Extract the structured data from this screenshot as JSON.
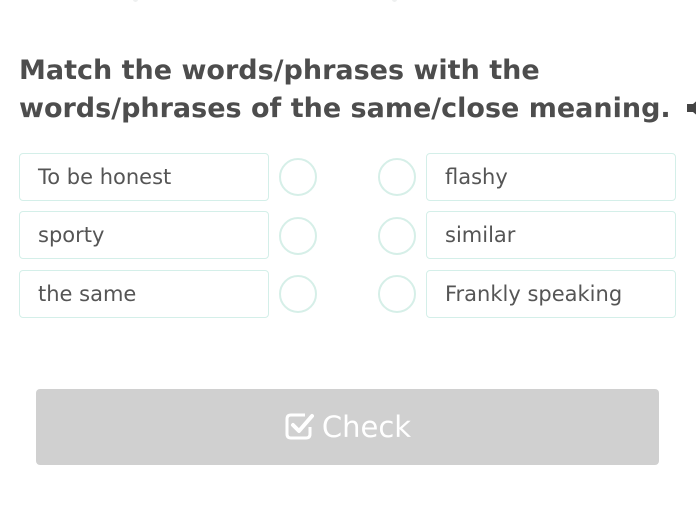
{
  "task": {
    "title_line1": "Match the words/phrases with the",
    "title_line2": "words/phrases of the same/close meaning.",
    "audio_icon": "speaker-volume-icon"
  },
  "left_items": [
    {
      "label": "To be honest"
    },
    {
      "label": "sporty"
    },
    {
      "label": "the same"
    }
  ],
  "right_items": [
    {
      "label": "flashy"
    },
    {
      "label": "similar"
    },
    {
      "label": "Frankly speaking"
    }
  ],
  "check_button": {
    "label": "Check",
    "icon": "checkbox-check-icon",
    "state": "disabled"
  },
  "colors": {
    "title_text": "#4d4d4d",
    "card_border": "#d4efe9",
    "connector_border": "#d6efe8",
    "button_bg_disabled": "#d0d0d0",
    "button_text": "#ffffff"
  }
}
